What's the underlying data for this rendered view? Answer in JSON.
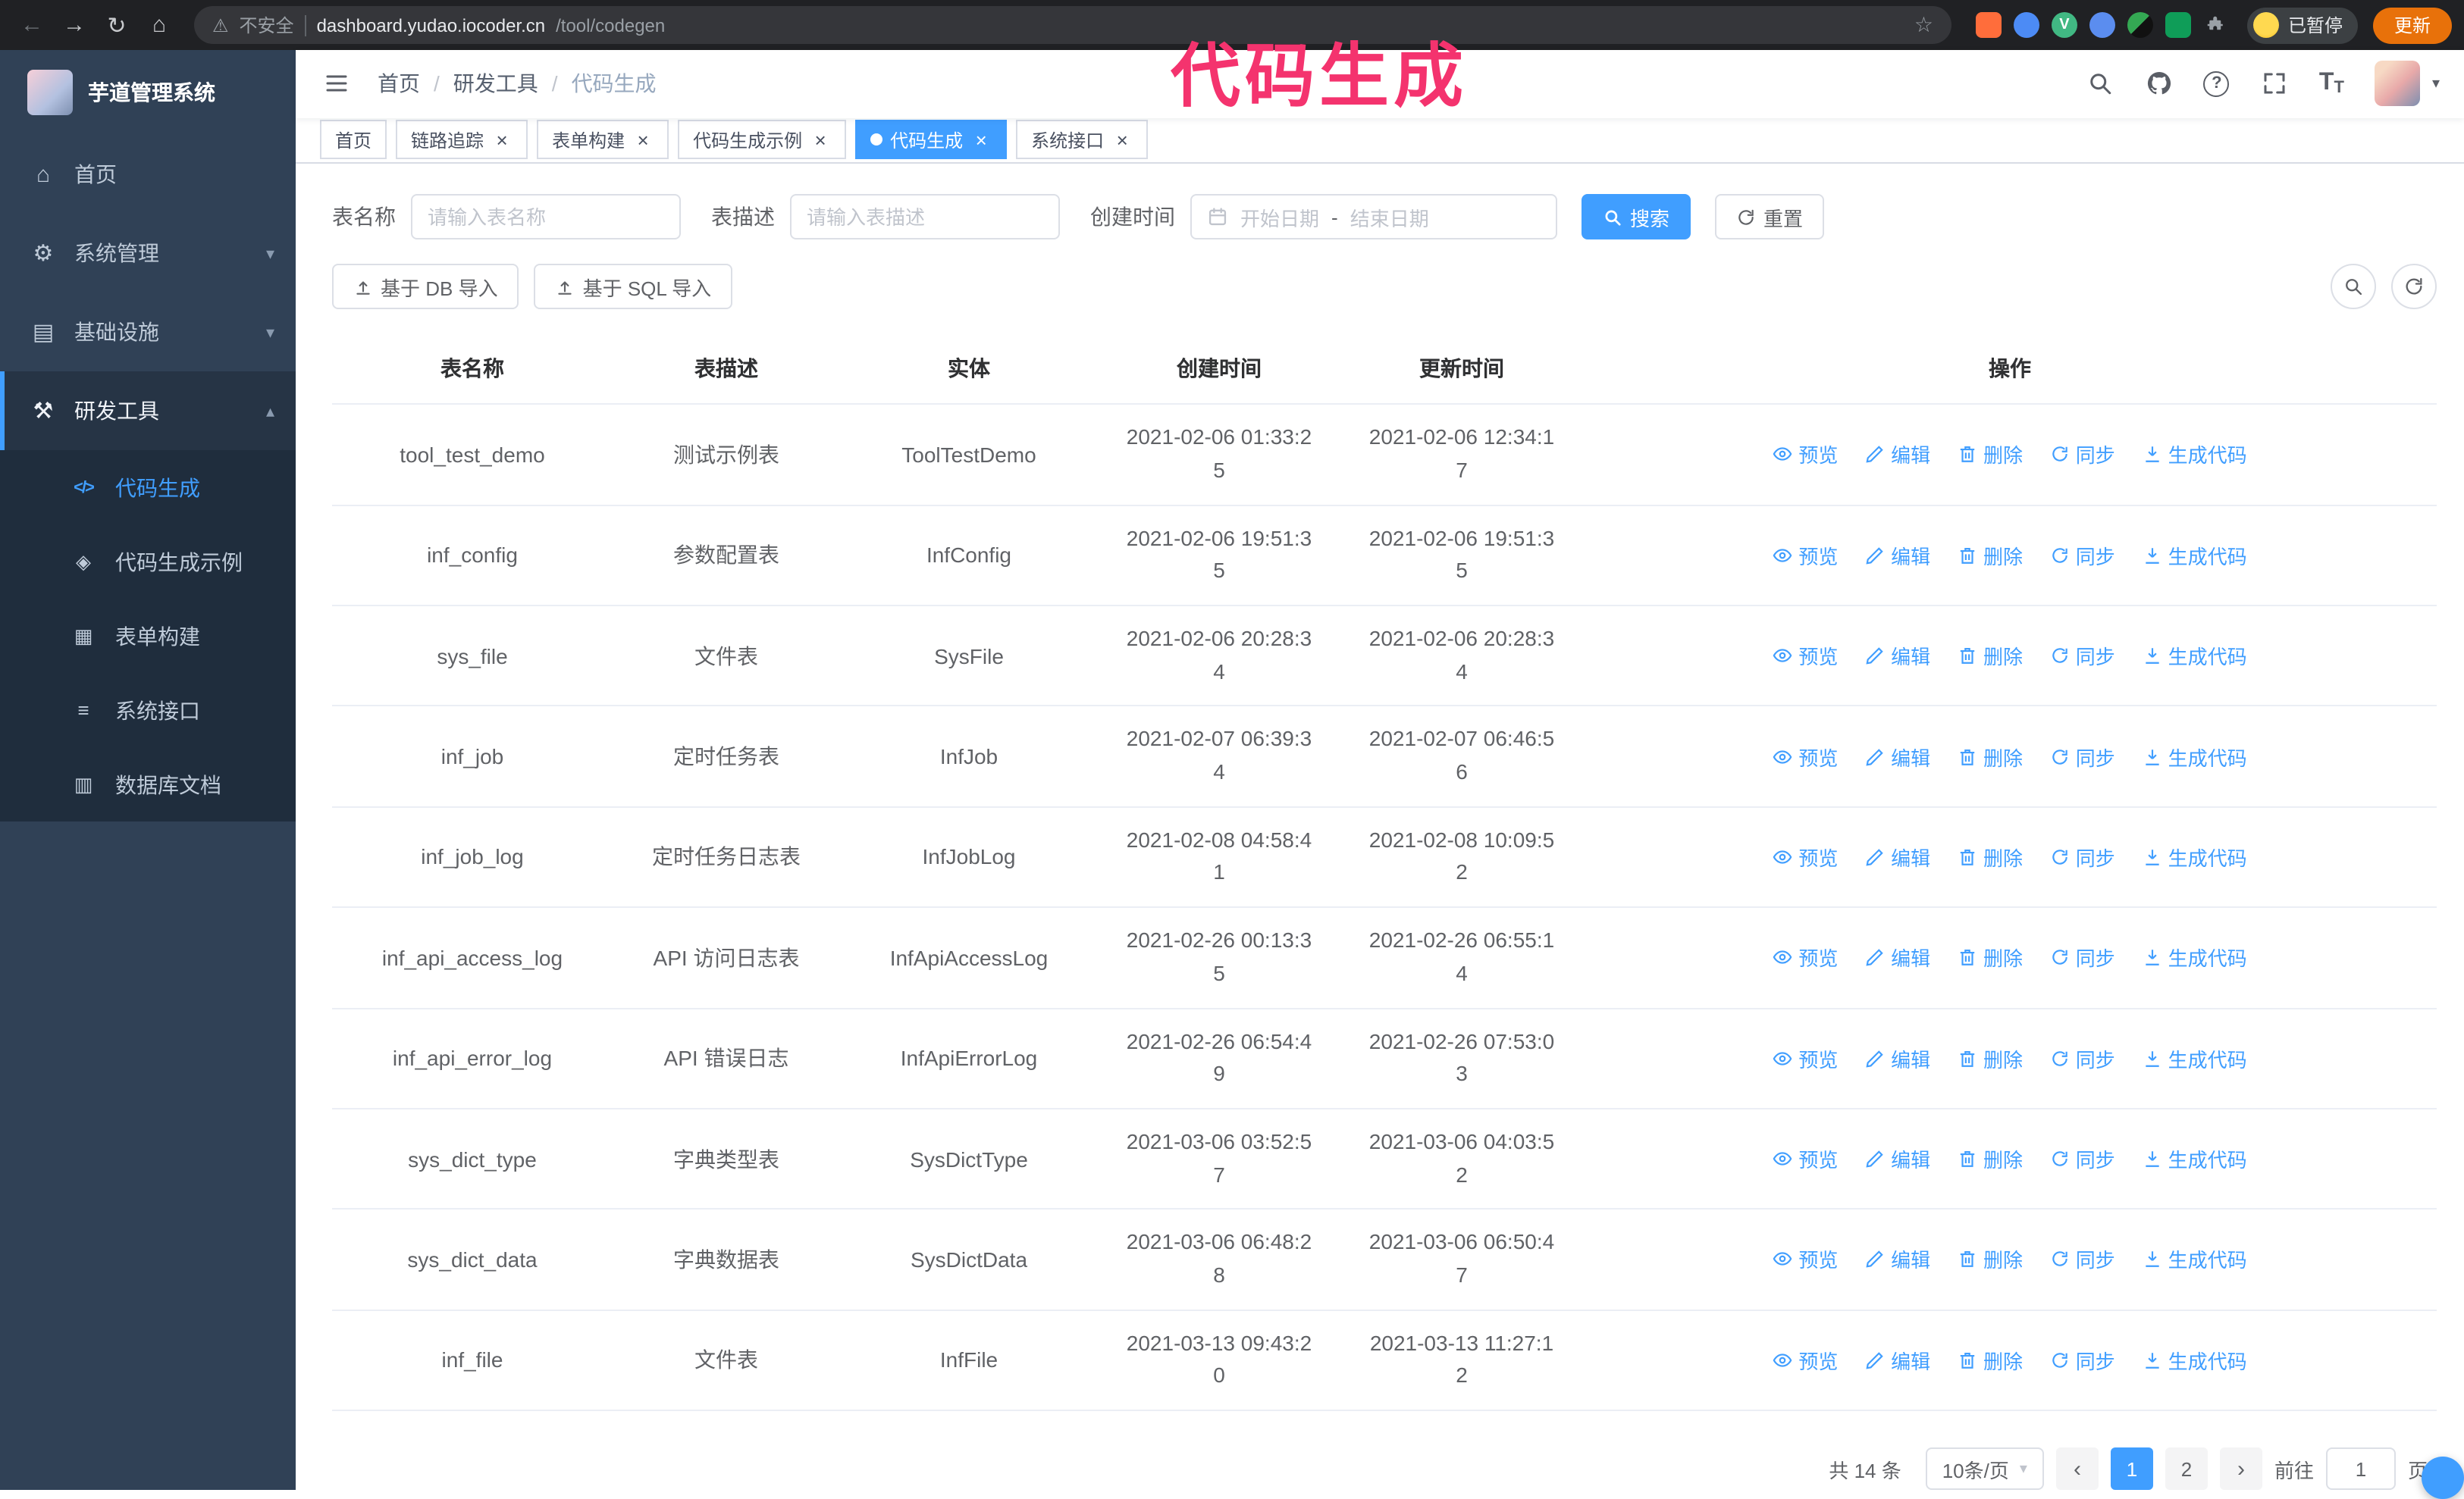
{
  "browser": {
    "security_label": "不安全",
    "url_host": "dashboard.yudao.iocoder.cn",
    "url_path": "/tool/codegen",
    "paused_badge": "已暂停",
    "update_button": "更新"
  },
  "annotation": {
    "text": "代码生成",
    "color": "#f4336e"
  },
  "sidebar": {
    "logo_title": "芋道管理系统",
    "items": [
      {
        "label": "首页"
      },
      {
        "label": "系统管理"
      },
      {
        "label": "基础设施"
      },
      {
        "label": "研发工具"
      }
    ],
    "subitems": [
      {
        "label": "代码生成"
      },
      {
        "label": "代码生成示例"
      },
      {
        "label": "表单构建"
      },
      {
        "label": "系统接口"
      },
      {
        "label": "数据库文档"
      }
    ]
  },
  "breadcrumb": [
    "首页",
    "研发工具",
    "代码生成"
  ],
  "tabs": [
    {
      "label": "首页"
    },
    {
      "label": "链路追踪"
    },
    {
      "label": "表单构建"
    },
    {
      "label": "代码生成示例"
    },
    {
      "label": "代码生成"
    },
    {
      "label": "系统接口"
    }
  ],
  "filters": {
    "name_label": "表名称",
    "name_placeholder": "请输入表名称",
    "desc_label": "表描述",
    "desc_placeholder": "请输入表描述",
    "time_label": "创建时间",
    "date_start": "开始日期",
    "date_separator": "-",
    "date_end": "结束日期",
    "search": "搜索",
    "reset": "重置"
  },
  "toolbar": {
    "import_db": "基于 DB 导入",
    "import_sql": "基于 SQL 导入"
  },
  "table": {
    "columns": [
      "表名称",
      "表描述",
      "实体",
      "创建时间",
      "更新时间",
      "操作"
    ],
    "actions": [
      "预览",
      "编辑",
      "删除",
      "同步",
      "生成代码"
    ],
    "rows": [
      {
        "name": "tool_test_demo",
        "desc": "测试示例表",
        "entity": "ToolTestDemo",
        "created": "2021-02-06 01:33:25",
        "updated": "2021-02-06 12:34:17"
      },
      {
        "name": "inf_config",
        "desc": "参数配置表",
        "entity": "InfConfig",
        "created": "2021-02-06 19:51:35",
        "updated": "2021-02-06 19:51:35"
      },
      {
        "name": "sys_file",
        "desc": "文件表",
        "entity": "SysFile",
        "created": "2021-02-06 20:28:34",
        "updated": "2021-02-06 20:28:34"
      },
      {
        "name": "inf_job",
        "desc": "定时任务表",
        "entity": "InfJob",
        "created": "2021-02-07 06:39:34",
        "updated": "2021-02-07 06:46:56"
      },
      {
        "name": "inf_job_log",
        "desc": "定时任务日志表",
        "entity": "InfJobLog",
        "created": "2021-02-08 04:58:41",
        "updated": "2021-02-08 10:09:52"
      },
      {
        "name": "inf_api_access_log",
        "desc": "API 访问日志表",
        "entity": "InfApiAccessLog",
        "created": "2021-02-26 00:13:35",
        "updated": "2021-02-26 06:55:14"
      },
      {
        "name": "inf_api_error_log",
        "desc": "API 错误日志",
        "entity": "InfApiErrorLog",
        "created": "2021-02-26 06:54:49",
        "updated": "2021-02-26 07:53:03"
      },
      {
        "name": "sys_dict_type",
        "desc": "字典类型表",
        "entity": "SysDictType",
        "created": "2021-03-06 03:52:57",
        "updated": "2021-03-06 04:03:52"
      },
      {
        "name": "sys_dict_data",
        "desc": "字典数据表",
        "entity": "SysDictData",
        "created": "2021-03-06 06:48:28",
        "updated": "2021-03-06 06:50:47"
      },
      {
        "name": "inf_file",
        "desc": "文件表",
        "entity": "InfFile",
        "created": "2021-03-13 09:43:20",
        "updated": "2021-03-13 11:27:12"
      }
    ]
  },
  "pagination": {
    "total": "共 14 条",
    "page_size": "10条/页",
    "pages": [
      "1",
      "2"
    ],
    "goto_label": "前往",
    "goto_value": "1",
    "goto_suffix": "页"
  },
  "icons": {
    "back": "←",
    "forward": "→",
    "reload": "↻",
    "home": "⌂",
    "warning": "⚠",
    "star": "☆",
    "vue_extension_letter": "V",
    "question": "?",
    "font_size_large": "T",
    "font_size_small": "T",
    "avatar_caret": "▾",
    "chevron_down": "▾",
    "chevron_up": "▴",
    "close": "×",
    "menu_home": "⌂",
    "menu_system": "⚙",
    "menu_infra": "▤",
    "menu_tools": "⚒",
    "submenu_codegen": "</>",
    "submenu_example": "◈",
    "submenu_form": "▦",
    "submenu_api": "≡",
    "submenu_dbdoc": "▥",
    "pager_prev": "‹",
    "pager_next": "›",
    "select_caret": "▾",
    "breadcrumb_separator": "/"
  }
}
